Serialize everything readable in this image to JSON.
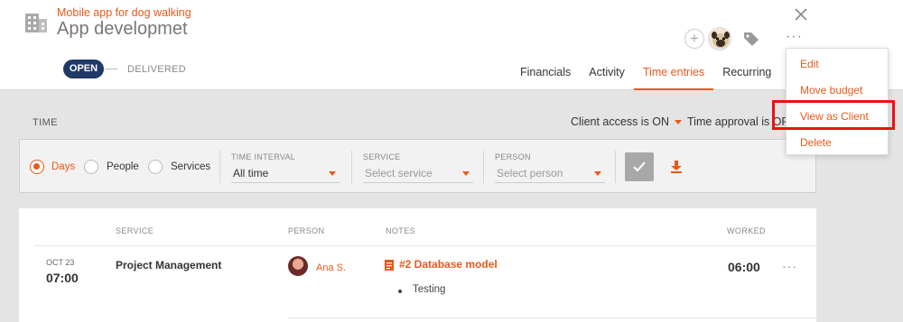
{
  "header": {
    "subtitle": "Mobile app for dog walking",
    "title": "App developmet",
    "status_open": "OPEN",
    "status_delivered": "DELIVERED",
    "plus_label": "+",
    "more_label": "···"
  },
  "tabs": [
    {
      "label": "Financials"
    },
    {
      "label": "Activity"
    },
    {
      "label": "Time entries"
    },
    {
      "label": "Recurring"
    }
  ],
  "menu": {
    "items": [
      "Edit",
      "Move budget",
      "View as Client",
      "Delete"
    ]
  },
  "time_bar": {
    "label": "TIME",
    "client_access": "Client access is ON",
    "time_approval": "Time approval is OFF"
  },
  "filters": {
    "radio": [
      "Days",
      "People",
      "Services"
    ],
    "time_interval_label": "TIME INTERVAL",
    "time_interval_value": "All time",
    "service_label": "SERVICE",
    "service_placeholder": "Select service",
    "person_label": "PERSON",
    "person_placeholder": "Select person"
  },
  "table": {
    "headers": [
      "SERVICE",
      "PERSON",
      "NOTES",
      "WORKED"
    ],
    "rows": [
      {
        "date": "OCT 23",
        "time": "07:00",
        "service": "Project Management",
        "person": "Ana S.",
        "note_title": "#2 Database model",
        "note_item": "Testing",
        "worked": "06:00",
        "more": "···"
      }
    ]
  },
  "colors": {
    "accent": "#e8591a",
    "status_open_bg": "#1f3a68",
    "highlight": "#ee1010"
  }
}
